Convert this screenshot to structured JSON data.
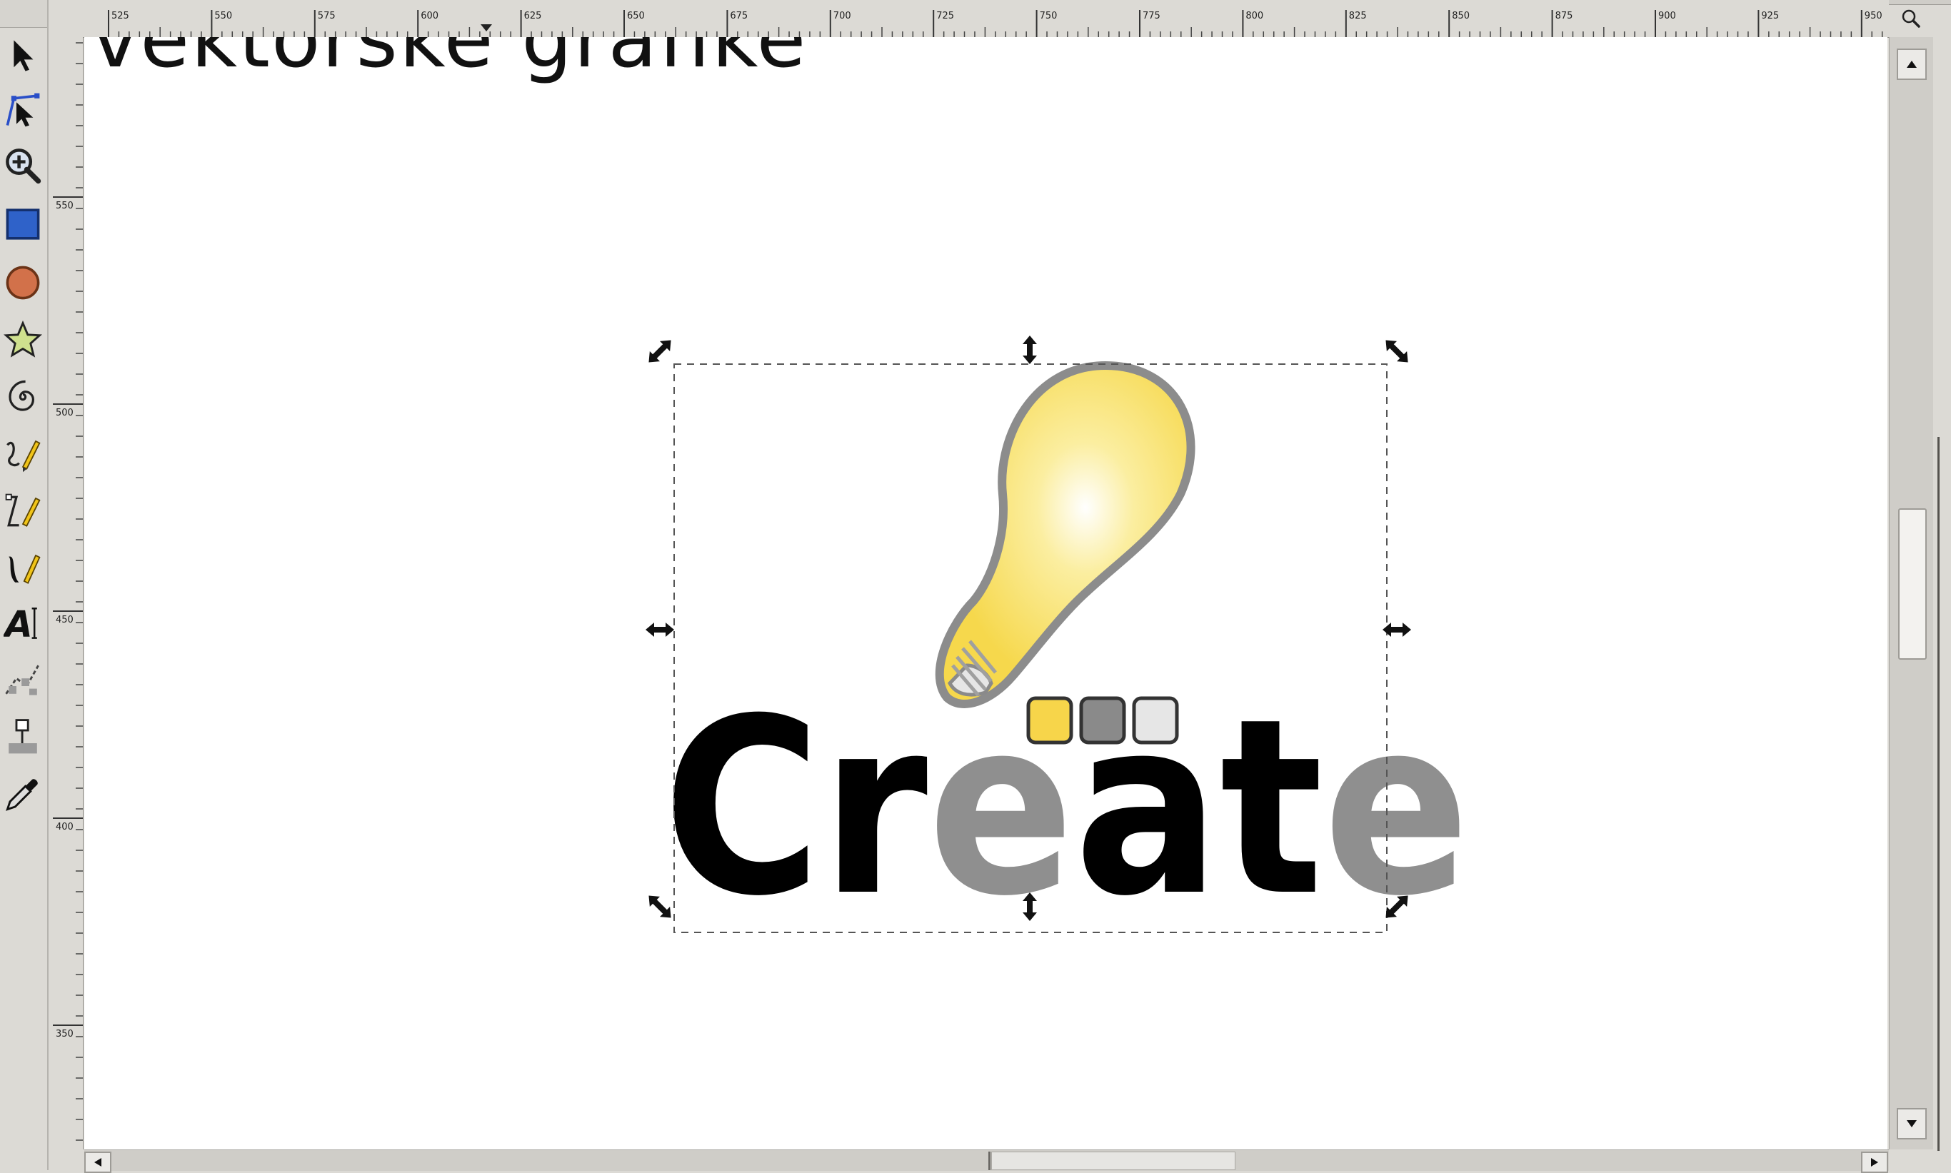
{
  "app": {
    "canvas_heading": "vektorske grafike"
  },
  "toolbox": {
    "tools": [
      {
        "name": "selector-tool",
        "icon": "arrow-pointer-icon"
      },
      {
        "name": "node-tool",
        "icon": "node-editor-icon"
      },
      {
        "name": "zoom-tool",
        "icon": "magnifier-plus-icon"
      },
      {
        "name": "rectangle-tool",
        "icon": "blue-rectangle-icon"
      },
      {
        "name": "ellipse-tool",
        "icon": "orange-circle-icon"
      },
      {
        "name": "star-tool",
        "icon": "star-icon"
      },
      {
        "name": "spiral-tool",
        "icon": "spiral-icon"
      },
      {
        "name": "pencil-tool",
        "icon": "freehand-pencil-icon"
      },
      {
        "name": "bezier-tool",
        "icon": "bezier-pen-icon"
      },
      {
        "name": "calligraphy-tool",
        "icon": "calligraphy-icon"
      },
      {
        "name": "text-tool",
        "icon": "text-A-icon"
      },
      {
        "name": "spray-tool",
        "icon": "spray-icon"
      },
      {
        "name": "connector-tool",
        "icon": "connector-icon"
      },
      {
        "name": "dropper-tool",
        "icon": "eyedropper-icon"
      }
    ]
  },
  "rulers": {
    "horizontal_labels": [
      "525",
      "550",
      "575",
      "600",
      "625",
      "650",
      "675",
      "700",
      "725",
      "750",
      "775",
      "800",
      "825",
      "850",
      "875",
      "900",
      "925",
      "950"
    ],
    "vertical_labels": [
      "550",
      "500",
      "450",
      "400",
      "350"
    ]
  },
  "artwork": {
    "logo_text": "Create",
    "swatch_colors": [
      "#f7d54a",
      "#8a8a8a",
      "#e6e6e6"
    ],
    "letter_colors": {
      "C": "#000000",
      "r": "#000000",
      "e": "#8f8f8f",
      "a": "#000000",
      "t": "#000000",
      "e2": "#8f8f8f"
    },
    "bulb_fill": "#f7d950",
    "bulb_stroke": "#8a8a8a"
  }
}
